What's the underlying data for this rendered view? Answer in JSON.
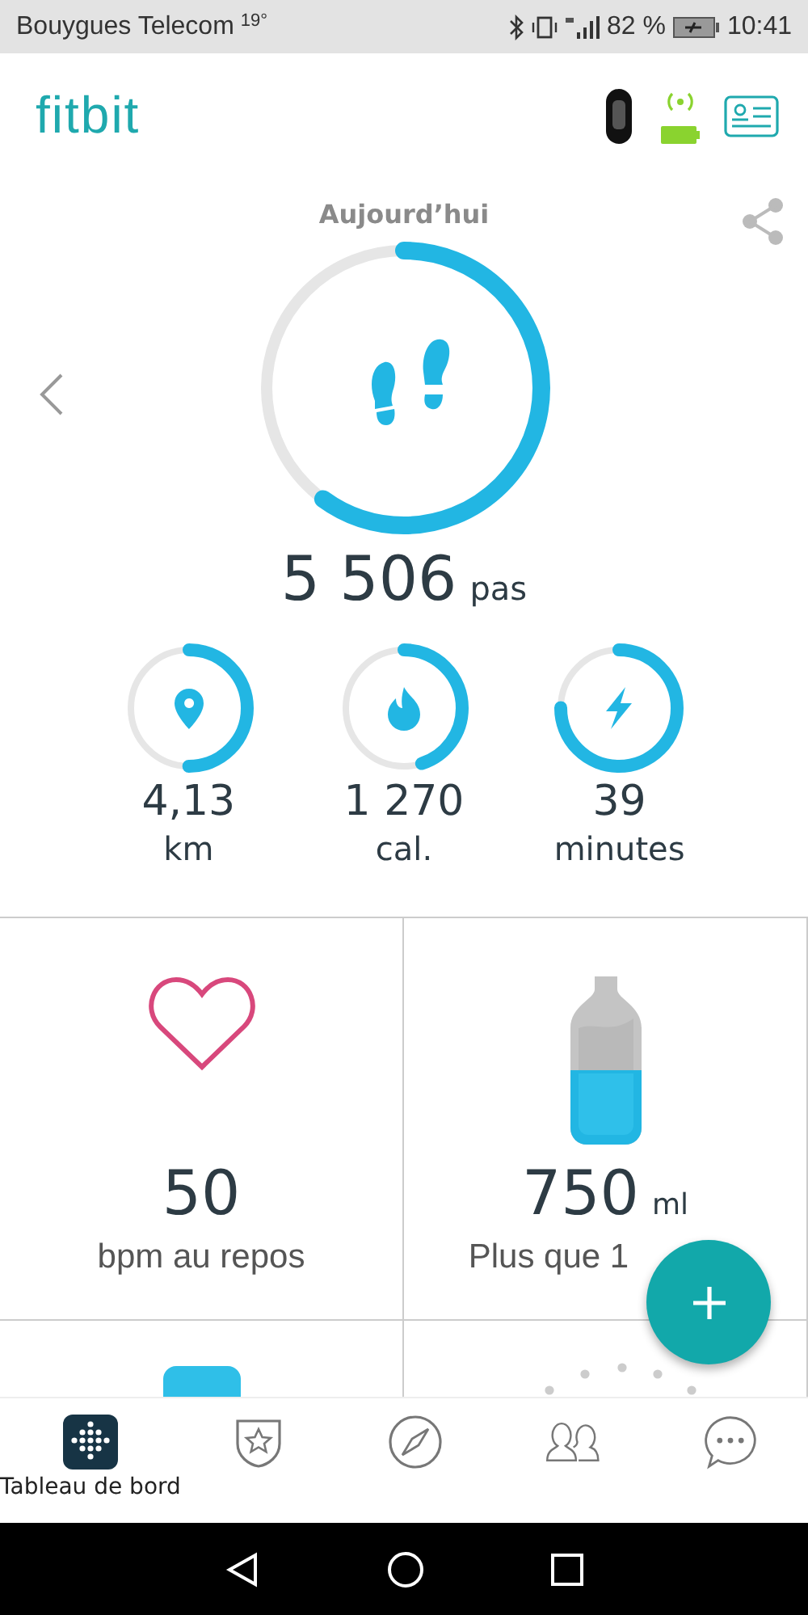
{
  "status_bar": {
    "carrier": "Bouygues Telecom",
    "temperature": "19°",
    "battery": "82 %",
    "time": "10:41"
  },
  "header": {
    "logo": "fitbit"
  },
  "summary": {
    "title": "Aujourd’hui",
    "steps": {
      "value": "5 506",
      "unit": "pas",
      "level": 0.6
    }
  },
  "stats": [
    {
      "kind": "location",
      "value": "4,13",
      "unit": "km",
      "level": 0.5
    },
    {
      "kind": "flame",
      "value": "1 270",
      "unit": "cal.",
      "level": 0.45
    },
    {
      "kind": "bolt",
      "value": "39",
      "unit": "minutes",
      "level": 0.75
    }
  ],
  "tiles": [
    {
      "kind": "heart",
      "value": "50",
      "label": "bpm au repos"
    },
    {
      "kind": "water",
      "value": "750",
      "unit": "ml",
      "label": "Plus que 1"
    }
  ],
  "nav": [
    {
      "kind": "dashboard",
      "label": "Tableau de bord",
      "selected": true
    },
    {
      "kind": "challenges",
      "selected": false
    },
    {
      "kind": "discover",
      "selected": false
    },
    {
      "kind": "friends",
      "selected": false
    },
    {
      "kind": "messages",
      "selected": false
    }
  ]
}
